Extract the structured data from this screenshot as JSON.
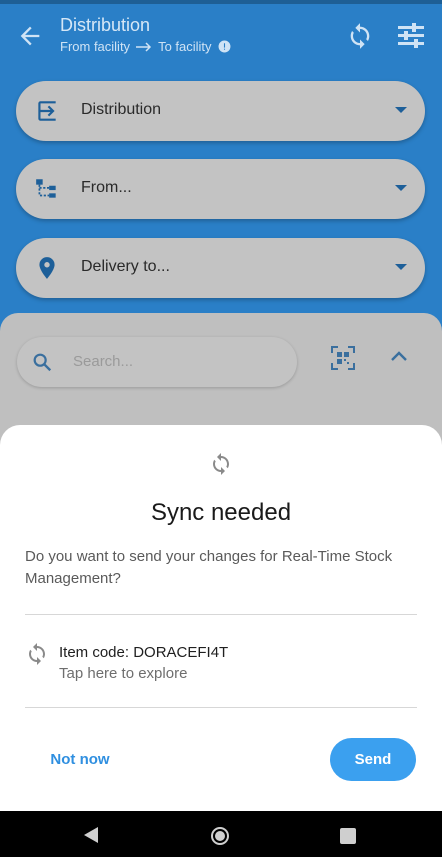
{
  "toolbar": {
    "title": "Distribution",
    "from_label": "From facility",
    "to_label": "To facility"
  },
  "selectors": [
    {
      "label": "Distribution",
      "icon": "login-icon"
    },
    {
      "label": "From...",
      "icon": "hierarchy-icon"
    },
    {
      "label": "Delivery to...",
      "icon": "location-pin-icon"
    }
  ],
  "search": {
    "placeholder": "Search..."
  },
  "dialog": {
    "title": "Sync needed",
    "message": "Do you want to send your changes for Real-Time Stock Management?",
    "item_code": "Item code: DORACEFI4T",
    "item_hint": "Tap here to explore",
    "cancel_label": "Not now",
    "confirm_label": "Send"
  },
  "colors": {
    "primary": "#2a7fc7",
    "accent": "#3ba0ef",
    "link": "#2f8fe0"
  }
}
